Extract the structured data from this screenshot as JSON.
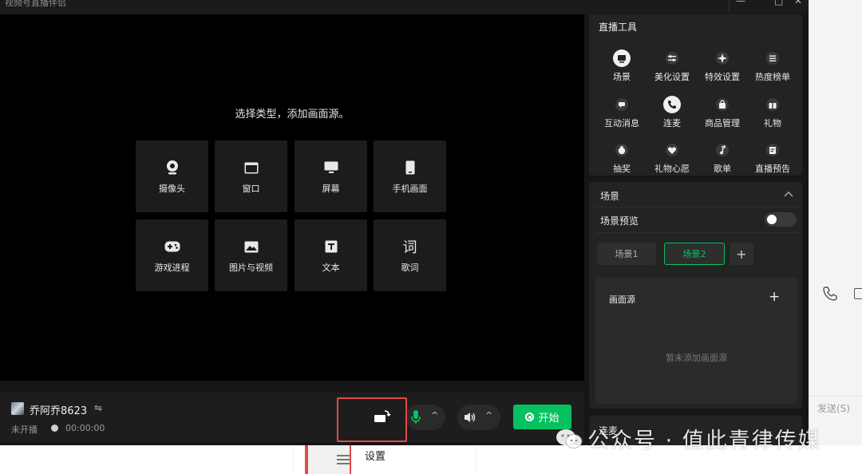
{
  "window": {
    "title": "视频号直播伴侣",
    "minimize_glyph": "—",
    "maximize_glyph": "□",
    "close_glyph": "✕"
  },
  "preview": {
    "hint": "选择类型，添加画面源。",
    "sources": [
      {
        "label": "摄像头",
        "icon": "camera-icon"
      },
      {
        "label": "窗口",
        "icon": "window-icon"
      },
      {
        "label": "屏幕",
        "icon": "monitor-icon"
      },
      {
        "label": "手机画面",
        "icon": "phone-icon"
      },
      {
        "label": "游戏进程",
        "icon": "gamepad-icon"
      },
      {
        "label": "图片与视频",
        "icon": "image-icon"
      },
      {
        "label": "文本",
        "icon": "text-icon"
      },
      {
        "label": "歌词",
        "icon": "lyrics-icon",
        "glyph": "词"
      }
    ]
  },
  "bottombar": {
    "username": "乔阿乔8623",
    "swap_glyph": "⇋",
    "status": "未开播",
    "timer": "00:00:00",
    "start_label": "开始",
    "caret_glyph": "^"
  },
  "tools": {
    "header": "直播工具",
    "items": [
      {
        "label": "场景",
        "icon": "scene-icon"
      },
      {
        "label": "美化设置",
        "icon": "beauty-settings-icon"
      },
      {
        "label": "特效设置",
        "icon": "effects-icon"
      },
      {
        "label": "热度榜单",
        "icon": "ranking-icon"
      },
      {
        "label": "互动消息",
        "icon": "message-icon"
      },
      {
        "label": "连麦",
        "icon": "co-host-icon"
      },
      {
        "label": "商品管理",
        "icon": "product-icon"
      },
      {
        "label": "礼物",
        "icon": "gift-icon"
      },
      {
        "label": "抽奖",
        "icon": "lottery-icon"
      },
      {
        "label": "礼物心愿",
        "icon": "gift-wish-icon"
      },
      {
        "label": "歌单",
        "icon": "playlist-icon"
      },
      {
        "label": "直播预告",
        "icon": "live-notice-icon"
      }
    ]
  },
  "scene": {
    "header": "场景",
    "preview_label": "场景预览",
    "preview_enabled": false,
    "scenes": [
      "场景1",
      "场景2"
    ],
    "active_scene": "场景2",
    "add_glyph": "+",
    "sources_header": "画面源",
    "empty_text": "暂未添加画面源"
  },
  "next_panel": {
    "header": "连麦"
  },
  "external": {
    "send_label": "发送(S)"
  },
  "taskbar": {
    "settings_label": "设置"
  },
  "watermark": "公众号 · 值此青律传媒",
  "colors": {
    "accent_green": "#07c160",
    "highlight_red": "#e04a4a",
    "panel": "#232323",
    "tile": "#1c1c1c"
  }
}
